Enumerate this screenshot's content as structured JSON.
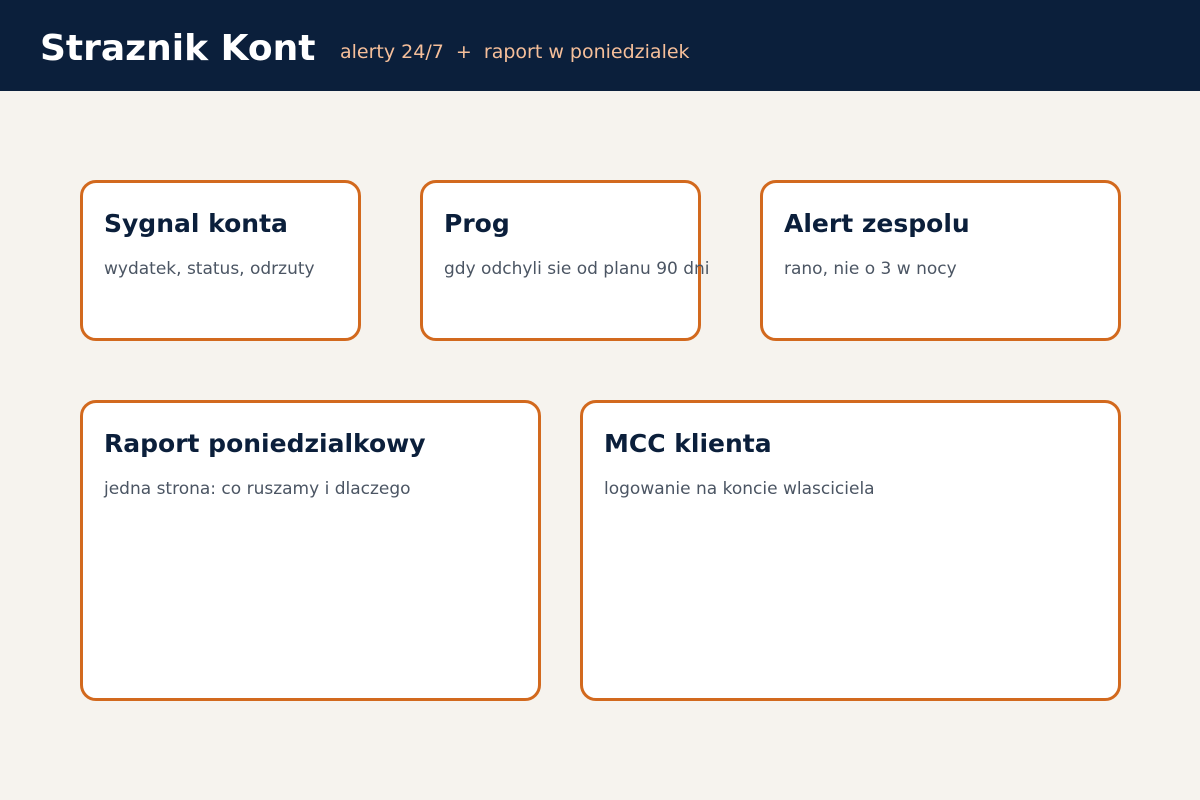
{
  "header": {
    "title": "Straznik Kont",
    "tagline": "alerty 24/7  +  raport w poniedzialek"
  },
  "cards": {
    "sygnal": {
      "title": "Sygnal konta",
      "text": "wydatek, status, odrzuty"
    },
    "prog": {
      "title": "Prog",
      "text": "gdy odchyli sie od planu 90 dni"
    },
    "alert": {
      "title": "Alert zespolu",
      "text": "rano, nie o 3 w nocy"
    },
    "raport": {
      "title": "Raport poniedzialkowy",
      "text": "jedna strona: co ruszamy i dlaczego"
    },
    "mcc": {
      "title": "MCC klienta",
      "text": "logowanie na koncie wlasciciela"
    }
  },
  "colors": {
    "header_background": "#0b1f3b",
    "page_background": "#f6f3ee",
    "accent": "#d2691e",
    "tagline": "#f6bf9a",
    "title_text": "#0b1f3b",
    "body_text": "#4b5563"
  }
}
